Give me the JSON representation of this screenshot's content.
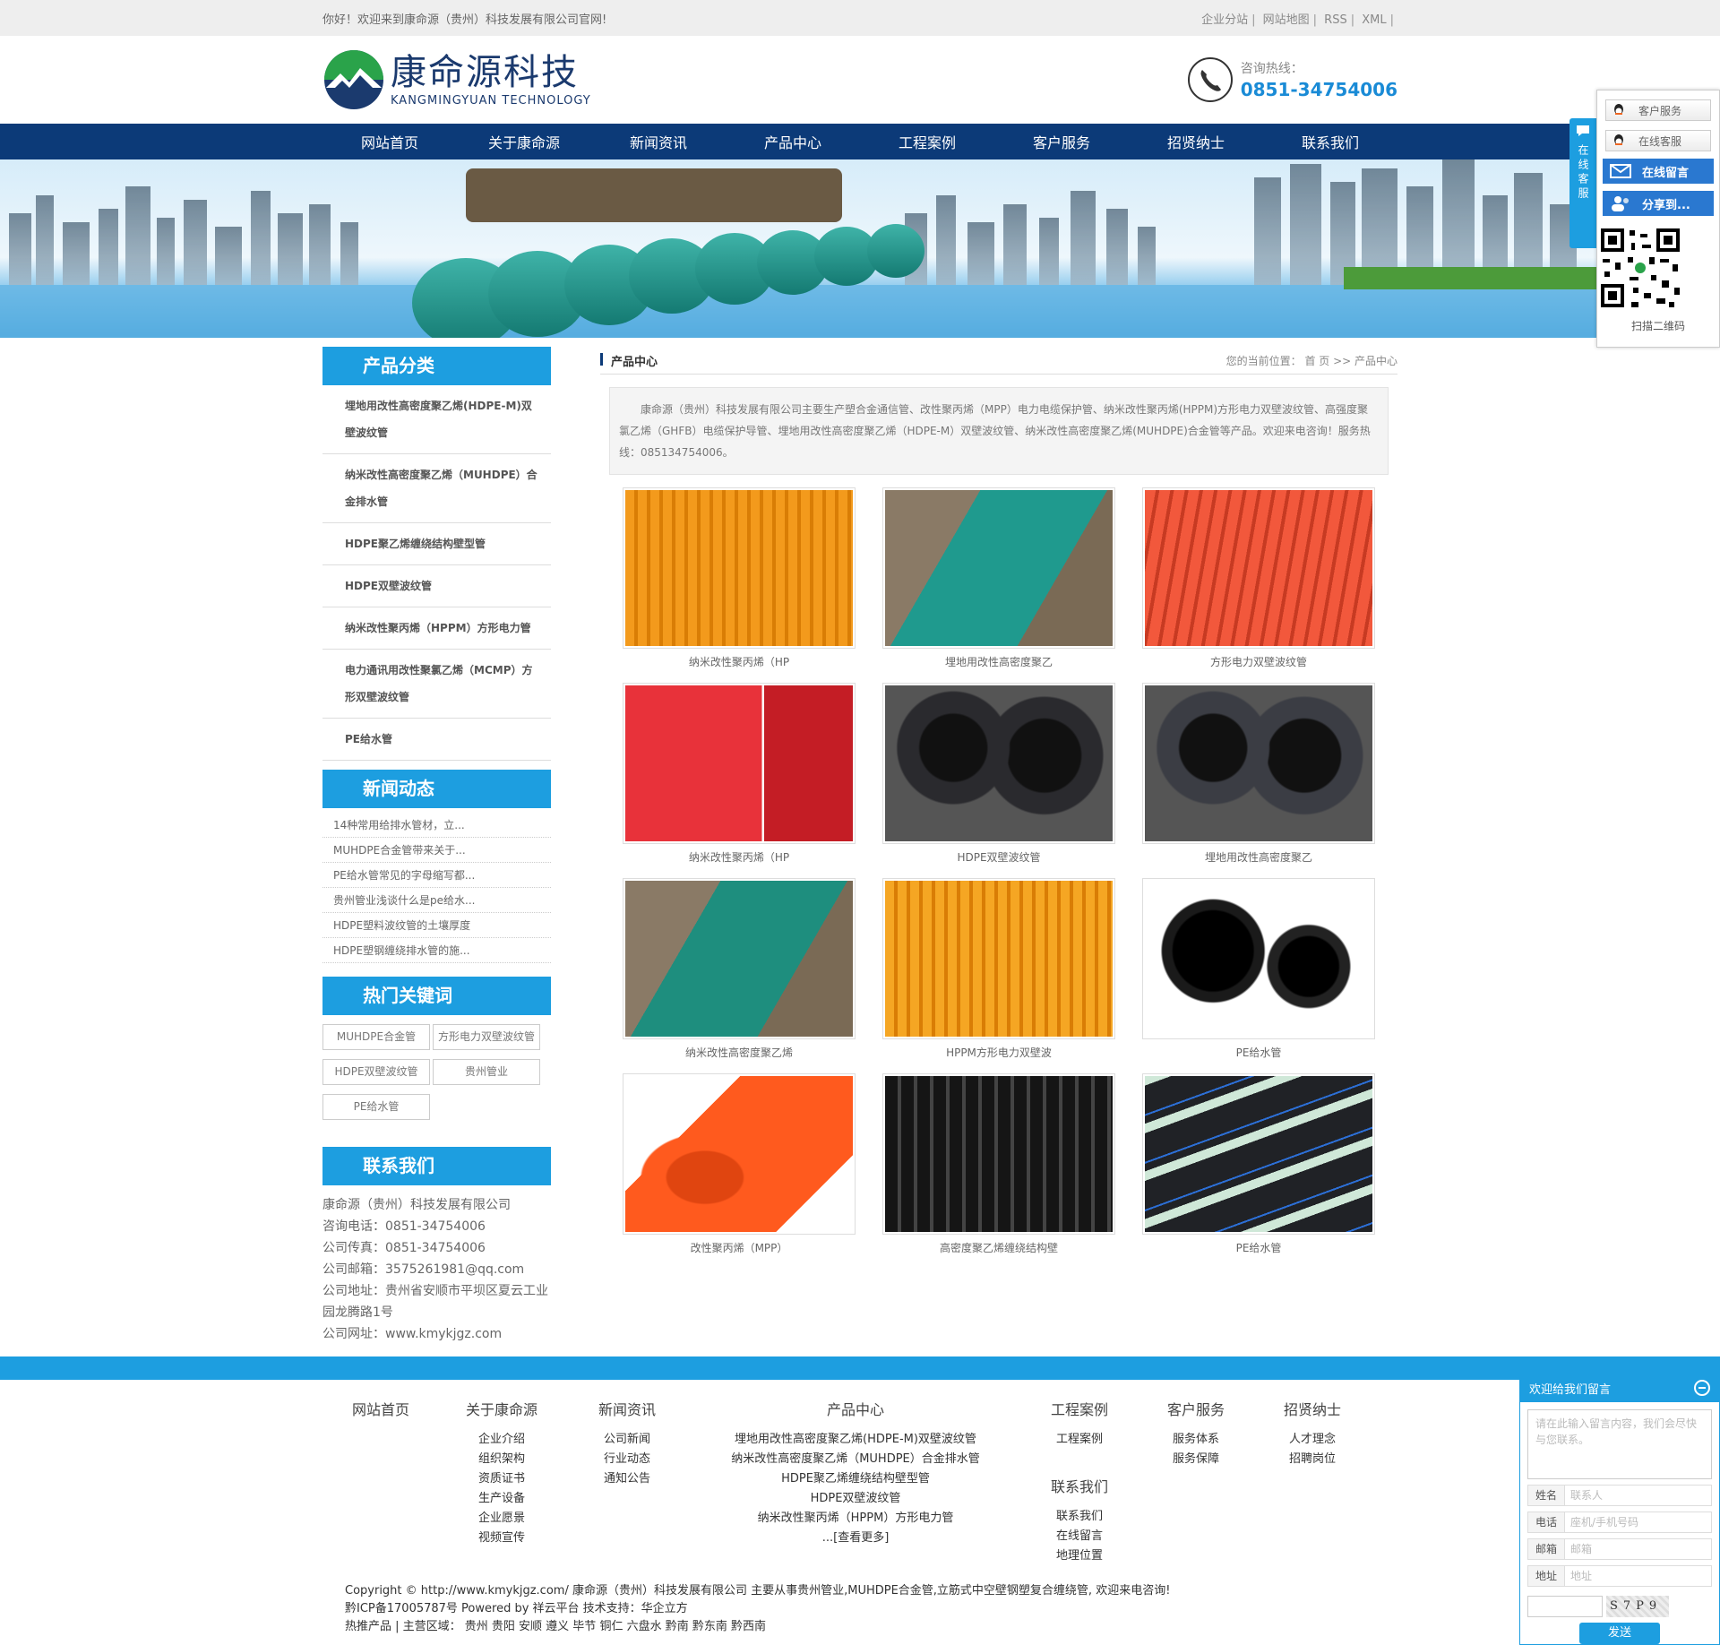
{
  "topbar": {
    "welcome": "你好！欢迎来到康命源（贵州）科技发展有限公司官网!",
    "links": [
      "企业分站",
      "网站地图",
      "RSS",
      "XML"
    ]
  },
  "header": {
    "logo_cn": "康命源科技",
    "logo_en": "KANGMINGYUAN  TECHNOLOGY",
    "hotline_label": "咨询热线：",
    "hotline_number": "0851-34754006"
  },
  "nav": [
    "网站首页",
    "关于康命源",
    "新闻资讯",
    "产品中心",
    "工程案例",
    "客户服务",
    "招贤纳士",
    "联系我们"
  ],
  "sidebar": {
    "category_title": "产品分类",
    "categories": [
      "埋地用改性高密度聚乙烯(HDPE-M)双壁波纹管",
      "纳米改性高密度聚乙烯（MUHDPE）合金排水管",
      "HDPE聚乙烯缠绕结构壁型管",
      "HDPE双壁波纹管",
      "纳米改性聚丙烯（HPPM）方形电力管",
      "电力通讯用改性聚氯乙烯（MCMP）方形双壁波纹管",
      "PE给水管"
    ],
    "news_title": "新闻动态",
    "news": [
      "14种常用给排水管材，立...",
      "MUHDPE合金管带来关于...",
      "PE给水管常见的字母缩写都...",
      "贵州管业浅谈什么是pe给水...",
      "HDPE塑料波纹管的土壤厚度",
      "HDPE塑钢缠绕排水管的施..."
    ],
    "keywords_title": "热门关键词",
    "keywords": [
      "MUHDPE合金管",
      "方形电力双壁波纹管",
      "HDPE双壁波纹管",
      "贵州管业",
      "PE给水管"
    ],
    "contact_title": "联系我们",
    "contact": [
      "康命源（贵州）科技发展有限公司",
      "咨询电话：0851-34754006",
      "公司传真：0851-34754006",
      "公司邮箱：3575261981@qq.com",
      "公司地址：贵州省安顺市平坝区夏云工业园龙腾路1号",
      "公司网址：www.kmykjgz.com"
    ]
  },
  "content": {
    "title": "产品中心",
    "location": "您的当前位置： 首 页 >> 产品中心",
    "intro": "康命源（贵州）科技发展有限公司主要生产塑合金通信管、改性聚丙烯（MPP）电力电缆保护管、纳米改性聚丙烯(HPPM)方形电力双壁波纹管、高强度聚氯乙烯（GHFB）电缆保护导管、埋地用改性高密度聚乙烯（HDPE-M）双壁波纹管、纳米改性高密度聚乙烯(MUHDPE)合金管等产品。欢迎来电咨询！服务热线：085134754006。",
    "products": [
      {
        "caption": "纳米改性聚丙烯（HP",
        "color": "#f39a1c",
        "style": "tubes-orange"
      },
      {
        "caption": "埋地用改性高密度聚乙",
        "color": "#1f9a8e",
        "style": "trench-green"
      },
      {
        "caption": "方形电力双壁波纹管",
        "color": "#f2583c",
        "style": "tubes-red"
      },
      {
        "caption": "纳米改性聚丙烯（HP",
        "color": "#e8323a",
        "style": "red-split"
      },
      {
        "caption": "HDPE双壁波纹管",
        "color": "#2a2a2e",
        "style": "black-pipes"
      },
      {
        "caption": "埋地用改性高密度聚乙",
        "color": "#3b3d44",
        "style": "grey-pipes"
      },
      {
        "caption": "纳米改性高密度聚乙烯",
        "color": "#1e8e7e",
        "style": "green-trench"
      },
      {
        "caption": "HPPM方形电力双壁波",
        "color": "#f5a623",
        "style": "yellow-pile"
      },
      {
        "caption": "PE给水管",
        "color": "#1a1a1a",
        "style": "pe-black"
      },
      {
        "caption": "改性聚丙烯（MPP）",
        "color": "#ff5a1e",
        "style": "mpp-orange"
      },
      {
        "caption": "高密度聚乙烯缠绕结构壁",
        "color": "#151515",
        "style": "winding"
      },
      {
        "caption": "PE给水管",
        "color": "#202226",
        "style": "pe-water"
      }
    ]
  },
  "footer": {
    "columns": [
      {
        "head": "网站首页",
        "links": []
      },
      {
        "head": "关于康命源",
        "links": [
          "企业介绍",
          "组织架构",
          "资质证书",
          "生产设备",
          "企业愿景",
          "视频宣传"
        ]
      },
      {
        "head": "新闻资讯",
        "links": [
          "公司新闻",
          "行业动态",
          "通知公告"
        ]
      },
      {
        "head": "产品中心",
        "links": [
          "埋地用改性高密度聚乙烯(HDPE-M)双壁波纹管",
          "纳米改性高密度聚乙烯（MUHDPE）合金排水管",
          "HDPE聚乙烯缠绕结构壁型管",
          "HDPE双壁波纹管",
          "纳米改性聚丙烯（HPPM）方形电力管",
          "...[查看更多]"
        ]
      },
      {
        "head": "工程案例",
        "links": [
          "工程案例"
        ],
        "head2": "联系我们",
        "links2": [
          "联系我们",
          "在线留言",
          "地理位置"
        ]
      },
      {
        "head": "客户服务",
        "links": [
          "服务体系",
          "服务保障"
        ]
      },
      {
        "head": "招贤纳士",
        "links": [
          "人才理念",
          "招聘岗位"
        ]
      }
    ],
    "copyright": "Copyright © http://www.kmykjgz.com/ 康命源（贵州）科技发展有限公司  主要从事贵州管业,MUHDPE合金管,立筋式中空壁钢塑复合缠绕管, 欢迎来电咨询!",
    "icp": "黔ICP备17005787号  Powered by 祥云平台  技术支持：华企立方",
    "regions": "热推产品 | 主营区域： 贵州 贵阳 安顺 遵义 毕节 铜仁 六盘水 黔南 黔东南 黔西南"
  },
  "float": {
    "tab_label": "在线客服",
    "btn_service": "客户服务",
    "btn_online": "在线客服",
    "btn_message": "在线留言",
    "btn_share": "分享到...",
    "qr_caption": "扫描二维码"
  },
  "message_box": {
    "title": "欢迎给我们留言",
    "placeholder": "请在此输入留言内容，我们会尽快与您联系。",
    "fields": [
      {
        "label": "姓名",
        "placeholder": "联系人"
      },
      {
        "label": "电话",
        "placeholder": "座机/手机号码"
      },
      {
        "label": "邮箱",
        "placeholder": "邮箱"
      },
      {
        "label": "地址",
        "placeholder": "地址"
      }
    ],
    "captcha": "S7P9",
    "send": "发送"
  }
}
